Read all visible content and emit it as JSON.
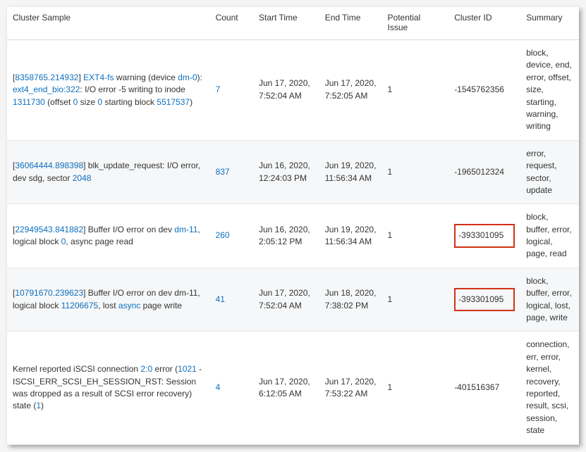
{
  "headers": {
    "sample": "Cluster Sample",
    "count": "Count",
    "start": "Start Time",
    "end": "End Time",
    "issue": "Potential Issue",
    "cluster": "Cluster ID",
    "summary": "Summary"
  },
  "rows": [
    {
      "sample_parts": [
        {
          "t": "[",
          "l": false
        },
        {
          "t": "8358765.214932",
          "l": true
        },
        {
          "t": "] ",
          "l": false
        },
        {
          "t": "EXT4-fs",
          "l": true
        },
        {
          "t": " warning (device ",
          "l": false
        },
        {
          "t": "dm-0",
          "l": true
        },
        {
          "t": "): ",
          "l": false
        },
        {
          "t": "ext4_end_bio:322",
          "l": true
        },
        {
          "t": ": I/O error -5 writing to inode ",
          "l": false
        },
        {
          "t": "1311730",
          "l": true
        },
        {
          "t": " (offset ",
          "l": false
        },
        {
          "t": "0",
          "l": true
        },
        {
          "t": " size ",
          "l": false
        },
        {
          "t": "0",
          "l": true
        },
        {
          "t": " starting block ",
          "l": false
        },
        {
          "t": "5517537",
          "l": true
        },
        {
          "t": ")",
          "l": false
        }
      ],
      "count": "7",
      "start": "Jun 17, 2020, 7:52:04 AM",
      "end": "Jun 17, 2020, 7:52:05 AM",
      "issue": "1",
      "cluster": "-1545762356",
      "summary": "block, device, end, error, offset, size, starting, warning, writing",
      "highlight": false
    },
    {
      "sample_parts": [
        {
          "t": "[",
          "l": false
        },
        {
          "t": "36064444.898398",
          "l": true
        },
        {
          "t": "] blk_update_request: I/O error, dev sdg, sector ",
          "l": false
        },
        {
          "t": "2048",
          "l": true
        }
      ],
      "count": "837",
      "start": "Jun 16, 2020, 12:24:03 PM",
      "end": "Jun 19, 2020, 11:56:34 AM",
      "issue": "1",
      "cluster": "-1965012324",
      "summary": "error, request, sector, update",
      "highlight": false
    },
    {
      "sample_parts": [
        {
          "t": "[",
          "l": false
        },
        {
          "t": "22949543.841882",
          "l": true
        },
        {
          "t": "] Buffer I/O error on dev ",
          "l": false
        },
        {
          "t": "dm-11",
          "l": true
        },
        {
          "t": ", logical block ",
          "l": false
        },
        {
          "t": "0",
          "l": true
        },
        {
          "t": ", async page read",
          "l": false
        }
      ],
      "count": "260",
      "start": "Jun 16, 2020, 2:05:12 PM",
      "end": "Jun 19, 2020, 11:56:34 AM",
      "issue": "1",
      "cluster": "-393301095",
      "summary": "block, buffer, error, logical, page, read",
      "highlight": true
    },
    {
      "sample_parts": [
        {
          "t": "[",
          "l": false
        },
        {
          "t": "10791670.239623",
          "l": true
        },
        {
          "t": "] Buffer I/O error on dev dm-11, logical block ",
          "l": false
        },
        {
          "t": "11206675",
          "l": true
        },
        {
          "t": ", lost ",
          "l": false
        },
        {
          "t": "async",
          "l": true
        },
        {
          "t": " page write",
          "l": false
        }
      ],
      "count": "41",
      "start": "Jun 17, 2020, 7:52:04 AM",
      "end": "Jun 18, 2020, 7:38:02 PM",
      "issue": "1",
      "cluster": "-393301095",
      "summary": "block, buffer, error, logical, lost, page, write",
      "highlight": true
    },
    {
      "sample_parts": [
        {
          "t": " Kernel reported iSCSI connection ",
          "l": false
        },
        {
          "t": "2:0",
          "l": true
        },
        {
          "t": " error (",
          "l": false
        },
        {
          "t": "1021",
          "l": true
        },
        {
          "t": " - ISCSI_ERR_SCSI_EH_SESSION_RST: Session was dropped as a result of SCSI error recovery) state (",
          "l": false
        },
        {
          "t": "1",
          "l": true
        },
        {
          "t": ")",
          "l": false
        }
      ],
      "count": "4",
      "start": "Jun 17, 2020, 6:12:05 AM",
      "end": "Jun 17, 2020, 7:53:22 AM",
      "issue": "1",
      "cluster": "-401516367",
      "summary": "connection, err, error, kernel, recovery, reported, result, scsi, session, state",
      "highlight": false
    }
  ]
}
